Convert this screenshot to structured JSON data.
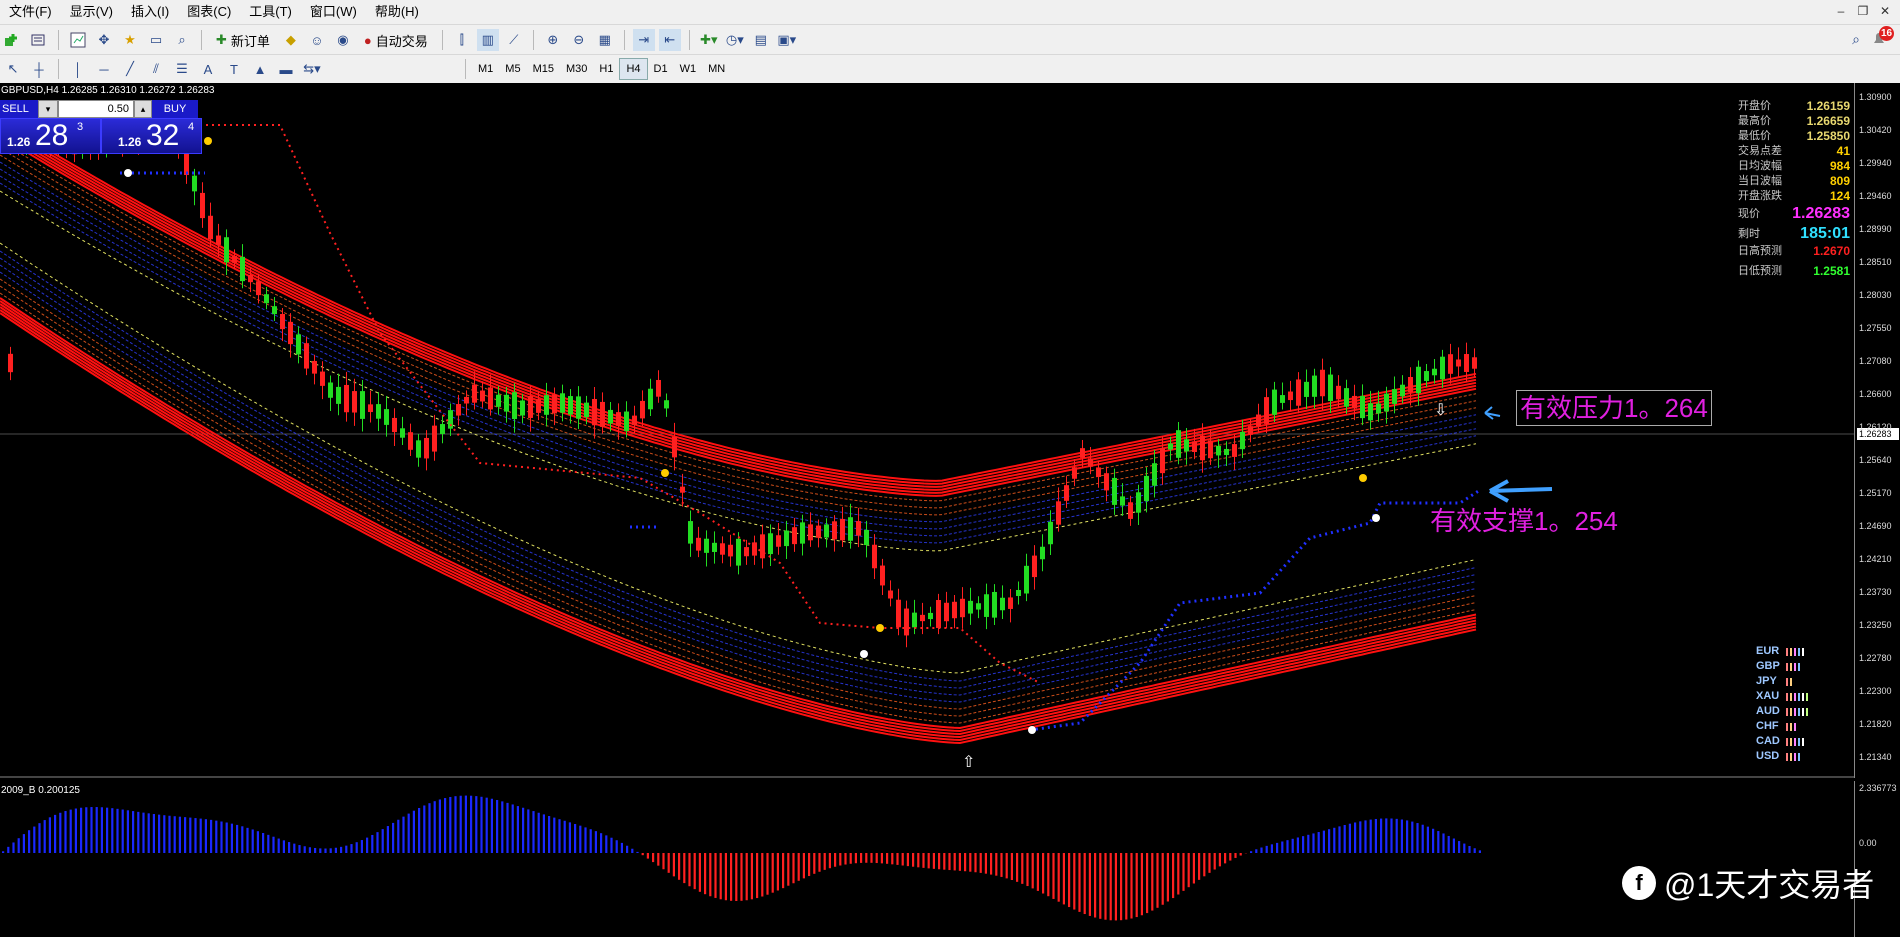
{
  "menu": [
    "文件(F)",
    "显示(V)",
    "插入(I)",
    "图表(C)",
    "工具(T)",
    "窗口(W)",
    "帮助(H)"
  ],
  "toolbar": {
    "new_order": "新订单",
    "auto_trading": "自动交易",
    "notification_count": "16"
  },
  "periods": [
    "M1",
    "M5",
    "M15",
    "M30",
    "H1",
    "H4",
    "D1",
    "W1",
    "MN"
  ],
  "active_period": "H4",
  "chart": {
    "info": "GBPUSD,H4  1.26285 1.26310 1.26272 1.26283",
    "indicator_label": "2009_B 0.200125",
    "price_ticks": [
      "1.30900",
      "1.30420",
      "1.29940",
      "1.29460",
      "1.28990",
      "1.28510",
      "1.28030",
      "1.27550",
      "1.27080",
      "1.26600",
      "1.26120",
      "1.25640",
      "1.25170",
      "1.24690",
      "1.24210",
      "1.23730",
      "1.23250",
      "1.22780",
      "1.22300",
      "1.21820",
      "1.21340"
    ],
    "current_price_tag": "1.26283",
    "indicator_ticks": [
      "2.336773",
      "0.00"
    ]
  },
  "one_click": {
    "sell_label": "SELL",
    "buy_label": "BUY",
    "volume": "0.50",
    "sell_prefix": "1.26",
    "sell_big": "28",
    "sell_sup": "3",
    "buy_prefix": "1.26",
    "buy_big": "32",
    "buy_sup": "4"
  },
  "stats": [
    {
      "label": "开盘价",
      "value": "1.26159",
      "color": "#e8d870"
    },
    {
      "label": "最高价",
      "value": "1.26659",
      "color": "#e8d870"
    },
    {
      "label": "最低价",
      "value": "1.25850",
      "color": "#e8d870"
    },
    {
      "label": "交易点差",
      "value": "41",
      "color": "#ffd000"
    },
    {
      "label": "日均波幅",
      "value": "984",
      "color": "#ffd000"
    },
    {
      "label": "当日波幅",
      "value": "809",
      "color": "#ffd000"
    },
    {
      "label": "开盘涨跌",
      "value": "124",
      "color": "#ffd000"
    }
  ],
  "current": {
    "label": "现价",
    "value": "1.26283",
    "color": "#ff30ff"
  },
  "countdown": {
    "label": "剩时",
    "value": "185:01",
    "color": "#30e0ff"
  },
  "forecast_high": {
    "label": "日高预测",
    "value": "1.2670",
    "color": "#ff2020"
  },
  "forecast_low": {
    "label": "日低预测",
    "value": "1.2581",
    "color": "#30ff30"
  },
  "currencies": [
    "EUR",
    "GBP",
    "JPY",
    "XAU",
    "AUD",
    "CHF",
    "CAD",
    "USD"
  ],
  "annotations": {
    "resistance": "有效压力1。264",
    "support": "有效支撑1。254"
  },
  "watermark": "@1天才交易者"
}
